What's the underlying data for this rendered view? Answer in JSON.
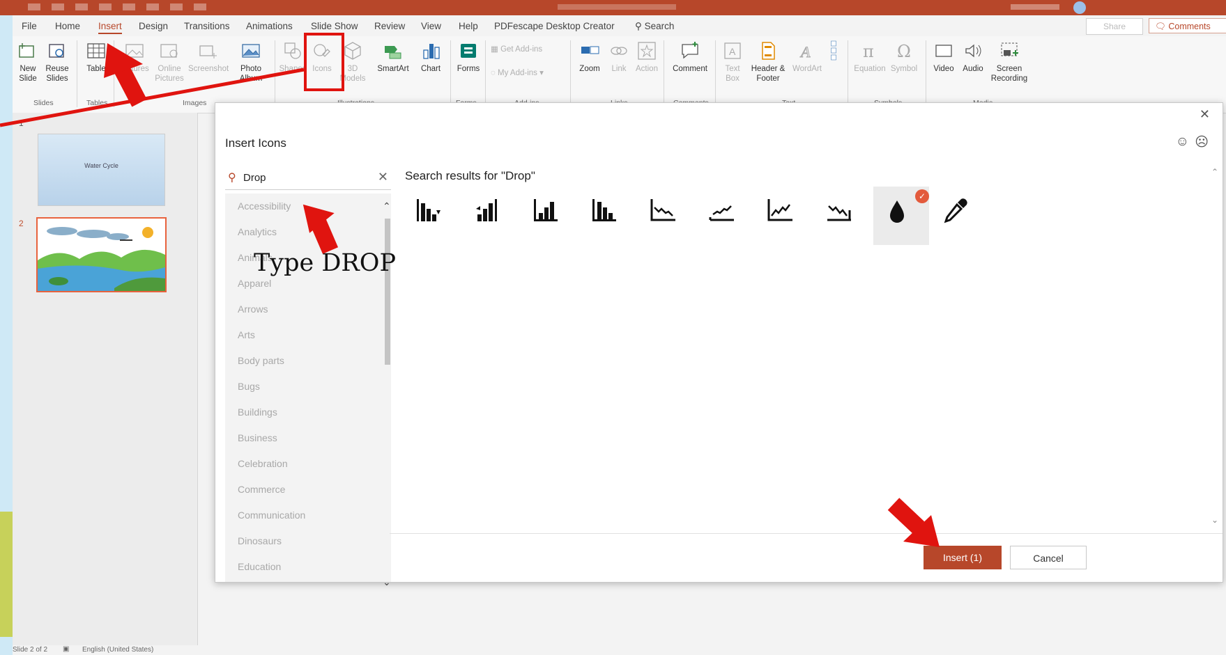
{
  "ribbon_tabs": [
    "File",
    "Home",
    "Insert",
    "Design",
    "Transitions",
    "Animations",
    "Slide Show",
    "Review",
    "View",
    "Help",
    "PDFescape Desktop Creator",
    "Search"
  ],
  "header_buttons": {
    "share": "Share",
    "comments": "Comments"
  },
  "ribbon": {
    "new_slide": "New Slide",
    "reuse_slides": "Reuse Slides",
    "table": "Table",
    "pictures": "Pictures",
    "online_pictures": "Online Pictures",
    "screenshot": "Screenshot",
    "photo_album": "Photo Album",
    "shapes": "Shapes",
    "icons": "Icons",
    "models_3d": "3D Models",
    "smartart": "SmartArt",
    "chart": "Chart",
    "forms": "Forms",
    "get_addins": "Get Add-ins",
    "my_addins": "My Add-ins",
    "zoom": "Zoom",
    "link": "Link",
    "action": "Action",
    "comment": "Comment",
    "text_box": "Text Box",
    "header_footer": "Header & Footer",
    "wordart": "WordArt",
    "equation": "Equation",
    "symbol": "Symbol",
    "video": "Video",
    "audio": "Audio",
    "screen_recording": "Screen Recording",
    "groups": {
      "slides": "Slides",
      "tables": "Tables",
      "images": "Images",
      "illustrations": "Illustrations",
      "forms": "Forms",
      "addins": "Add-ins",
      "links": "Links",
      "comments": "Comments",
      "text": "Text",
      "symbols": "Symbols",
      "media": "Media"
    }
  },
  "slides": [
    {
      "number": "1",
      "title": "Water Cycle"
    },
    {
      "number": "2"
    }
  ],
  "dialog": {
    "title": "Insert Icons",
    "search_value": "Drop",
    "results_title": "Search results for \"Drop\"",
    "categories": [
      "Accessibility",
      "Analytics",
      "Animals",
      "Apparel",
      "Arrows",
      "Arts",
      "Body parts",
      "Bugs",
      "Buildings",
      "Business",
      "Celebration",
      "Commerce",
      "Communication",
      "Dinosaurs",
      "Education"
    ],
    "icons": [
      "bar-chart-down-icon",
      "bar-chart-up-icon",
      "bar-chart-up-frame-icon",
      "bar-chart-down-frame-icon",
      "line-chart-down-icon",
      "line-chart-up-icon",
      "line-chart-rise-icon",
      "line-chart-fall-icon",
      "water-drop-icon",
      "eyedropper-icon"
    ],
    "insert_label": "Insert (1)",
    "cancel_label": "Cancel"
  },
  "status": {
    "slide": "Slide 2 of 2",
    "language": "English (United States)"
  },
  "annotation": {
    "text": "Type DROP",
    "color": "#e0140f"
  },
  "colors": {
    "accent": "#b7472a",
    "check": "#e35a3c"
  }
}
